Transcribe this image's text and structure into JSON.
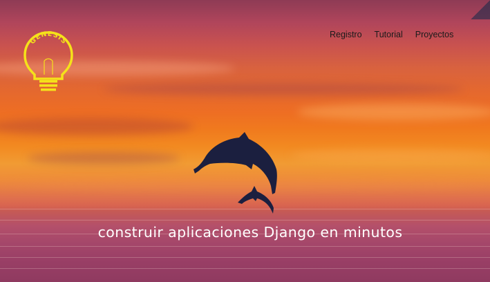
{
  "brand": {
    "logo_text": "GENESIS",
    "logo_color": "#f5e21a",
    "icon": "lightbulb-icon"
  },
  "nav": {
    "items": [
      {
        "label": "Registro"
      },
      {
        "label": "Tutorial"
      },
      {
        "label": "Proyectos"
      }
    ]
  },
  "hero": {
    "tagline": "construir aplicaciones Django en minutos",
    "image": "sunset-sea-dolphins"
  },
  "colors": {
    "sky_top": "#8e3b55",
    "sky_glow": "#f07a1e",
    "dolphin": "#1b1f3f",
    "text": "#ffffff"
  }
}
